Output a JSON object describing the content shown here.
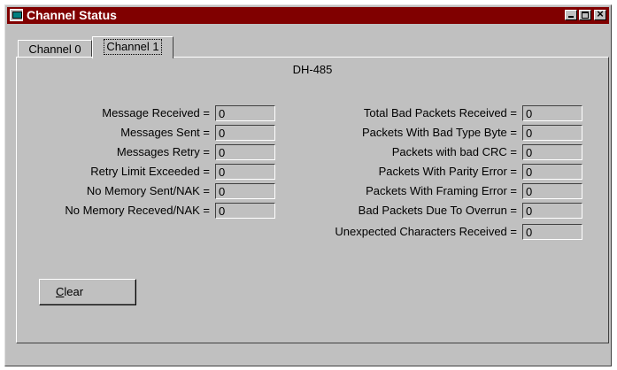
{
  "window": {
    "title": "Channel Status"
  },
  "tabs": [
    {
      "label": "Channel 0"
    },
    {
      "label": "Channel 1"
    }
  ],
  "section_title": "DH-485",
  "left_stats": [
    {
      "label": "Message Received =",
      "value": "0"
    },
    {
      "label": "Messages Sent =",
      "value": "0"
    },
    {
      "label": "Messages Retry =",
      "value": "0"
    },
    {
      "label": "Retry Limit Exceeded =",
      "value": "0"
    },
    {
      "label": "No Memory Sent/NAK =",
      "value": "0"
    },
    {
      "label": "No Memory Receved/NAK =",
      "value": "0"
    }
  ],
  "right_stats": [
    {
      "label": "Total Bad Packets Received =",
      "value": "0"
    },
    {
      "label": "Packets With Bad Type Byte =",
      "value": "0"
    },
    {
      "label": "Packets with bad CRC =",
      "value": "0"
    },
    {
      "label": "Packets With Parity Error =",
      "value": "0"
    },
    {
      "label": "Packets With Framing Error =",
      "value": "0"
    },
    {
      "label": "Bad Packets Due To Overrun =",
      "value": "0"
    },
    {
      "label": "Unexpected Characters Received =",
      "value": "0"
    }
  ],
  "buttons": {
    "clear_mnemonic": "C",
    "clear_rest": "lear"
  },
  "icons": {
    "title": "app-icon",
    "minimize": "minimize-icon",
    "maximize": "maximize-icon",
    "close": "close-icon"
  },
  "colors": {
    "titlebar": "#800000",
    "face": "#c0c0c0"
  }
}
